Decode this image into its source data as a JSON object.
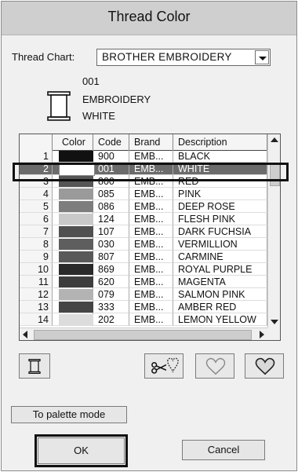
{
  "title": "Thread Color",
  "thread_chart": {
    "label": "Thread Chart:",
    "value": "BROTHER EMBROIDERY"
  },
  "selected_info": {
    "code": "001",
    "brand": "EMBROIDERY",
    "description": "WHITE"
  },
  "table": {
    "headers": [
      "Color",
      "Code",
      "Brand",
      "Description"
    ],
    "rows": [
      {
        "num": "1",
        "color": "#111111",
        "code": "900",
        "brand": "EMB...",
        "desc": "BLACK"
      },
      {
        "num": "2",
        "color": "#ffffff",
        "code": "001",
        "brand": "EMB...",
        "desc": "WHITE"
      },
      {
        "num": "3",
        "color": "#555555",
        "code": "800",
        "brand": "EMB...",
        "desc": "RED"
      },
      {
        "num": "4",
        "color": "#9a9a9a",
        "code": "085",
        "brand": "EMB...",
        "desc": "PINK"
      },
      {
        "num": "5",
        "color": "#7d7d7d",
        "code": "086",
        "brand": "EMB...",
        "desc": "DEEP ROSE"
      },
      {
        "num": "6",
        "color": "#c9c9c9",
        "code": "124",
        "brand": "EMB...",
        "desc": "FLESH PINK"
      },
      {
        "num": "7",
        "color": "#505050",
        "code": "107",
        "brand": "EMB...",
        "desc": "DARK FUCHSIA"
      },
      {
        "num": "8",
        "color": "#5e5e5e",
        "code": "030",
        "brand": "EMB...",
        "desc": "VERMILLION"
      },
      {
        "num": "9",
        "color": "#595959",
        "code": "807",
        "brand": "EMB...",
        "desc": "CARMINE"
      },
      {
        "num": "10",
        "color": "#2a2a2a",
        "code": "869",
        "brand": "EMB...",
        "desc": "ROYAL PURPLE"
      },
      {
        "num": "11",
        "color": "#3d3d3d",
        "code": "620",
        "brand": "EMB...",
        "desc": "MAGENTA"
      },
      {
        "num": "12",
        "color": "#b3b3b3",
        "code": "079",
        "brand": "EMB...",
        "desc": "SALMON PINK"
      },
      {
        "num": "13",
        "color": "#454545",
        "code": "333",
        "brand": "EMB...",
        "desc": "AMBER RED"
      },
      {
        "num": "14",
        "color": "#dcdcdc",
        "code": "202",
        "brand": "EMB...",
        "desc": "LEMON YELLOW"
      }
    ]
  },
  "selected_row": 2,
  "buttons": {
    "palette_mode": "To palette mode",
    "ok": "OK",
    "cancel": "Cancel"
  },
  "icons": [
    "spool-icon",
    "scissors-heart-icon",
    "heart-outline-icon",
    "heart-icon"
  ]
}
